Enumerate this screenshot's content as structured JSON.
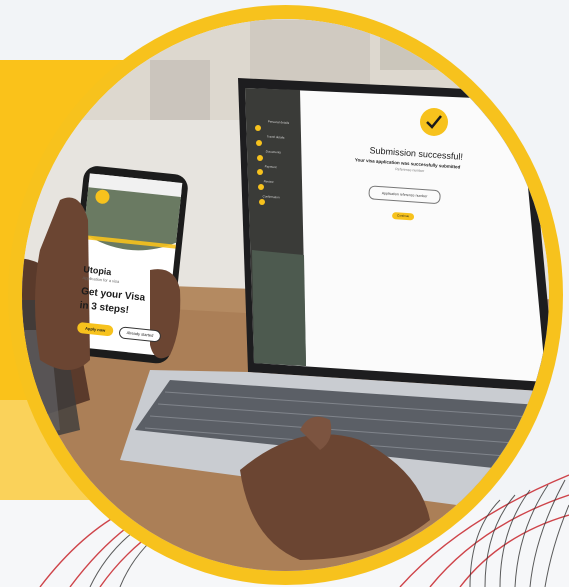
{
  "phone": {
    "location": "Utopia",
    "subtitle": "Application for a visa",
    "headline_line1": "Get your Visa",
    "headline_line2": "in 3 steps!",
    "apply_button": "Apply now",
    "secondary_button": "Already started"
  },
  "laptop": {
    "heading": "Submission successful!",
    "message": "Your visa application was successfully submitted",
    "sub_message": "Reference number",
    "field_text": "Application reference number",
    "button": "Continue",
    "sidebar_items": [
      "Personal details",
      "Travel details",
      "Documents",
      "Payment",
      "Review",
      "Confirmation"
    ]
  },
  "colors": {
    "brand_yellow": "#f7c21d",
    "dark": "#222222",
    "accent_red": "#c8252c"
  }
}
